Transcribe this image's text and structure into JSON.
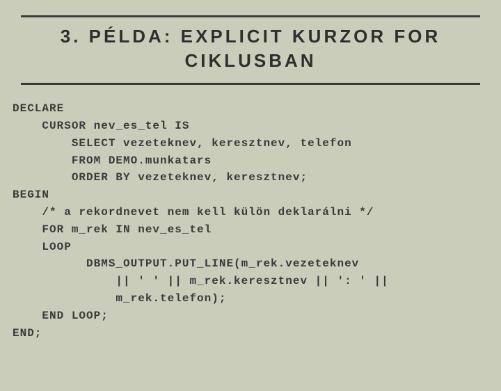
{
  "title": "3. PÉLDA: EXPLICIT KURZOR FOR CIKLUSBAN",
  "code_lines": [
    "DECLARE",
    "    CURSOR nev_es_tel IS",
    "        SELECT vezeteknev, keresztnev, telefon",
    "        FROM DEMO.munkatars",
    "        ORDER BY vezeteknev, keresztnev;",
    "BEGIN",
    "    /* a rekordnevet nem kell külön deklarálni */",
    "    FOR m_rek IN nev_es_tel",
    "    LOOP",
    "          DBMS_OUTPUT.PUT_LINE(m_rek.vezeteknev",
    "              || ' ' || m_rek.keresztnev || ': ' ||",
    "              m_rek.telefon);",
    "    END LOOP;",
    "END;"
  ]
}
